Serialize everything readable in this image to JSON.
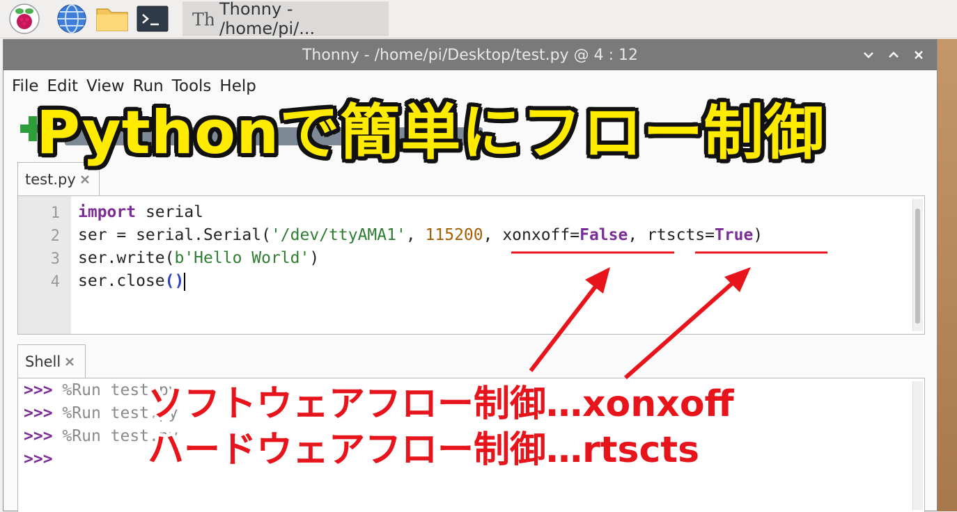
{
  "taskbar": {
    "icons": [
      "raspberry-icon",
      "globe-icon",
      "folder-icon",
      "terminal-icon"
    ],
    "task_label": "Thonny  -  /home/pi/..."
  },
  "window": {
    "title": "Thonny  -  /home/pi/Desktop/test.py  @  4 : 12"
  },
  "menu": [
    "File",
    "Edit",
    "View",
    "Run",
    "Tools",
    "Help"
  ],
  "editor": {
    "tab_label": "test.py",
    "line_numbers": [
      "1",
      "2",
      "3",
      "4"
    ],
    "line1": {
      "kw": "import",
      "rest": " serial"
    },
    "line2": {
      "a": "ser = serial.Serial(",
      "str": "'/dev/ttyAMA1'",
      "b": ", ",
      "num": "115200",
      "c": ", xonxoff=",
      "kw1": "False",
      "d": ", rtscts=",
      "kw2": "True",
      "e": ")"
    },
    "line3": {
      "a": "ser.write(",
      "str": "b'Hello World'",
      "b": ")"
    },
    "line4": {
      "a": "ser.close",
      "par": "()"
    }
  },
  "shell": {
    "tab_label": "Shell",
    "prompt": ">>>",
    "lines": [
      "%Run test.py",
      "%Run test.py",
      "%Run test.py",
      ""
    ]
  },
  "annotations": {
    "banner": "Pythonで簡単にフロー制御",
    "callout1": "ソフトウェアフロー制御…xonxoff",
    "callout2": "ハードウェアフロー制御…rtscts"
  },
  "colors": {
    "banner": "#ffeb00",
    "callout": "#e8141b",
    "keyword": "#7b2c96",
    "string": "#2e7d32",
    "number": "#a65e00"
  }
}
